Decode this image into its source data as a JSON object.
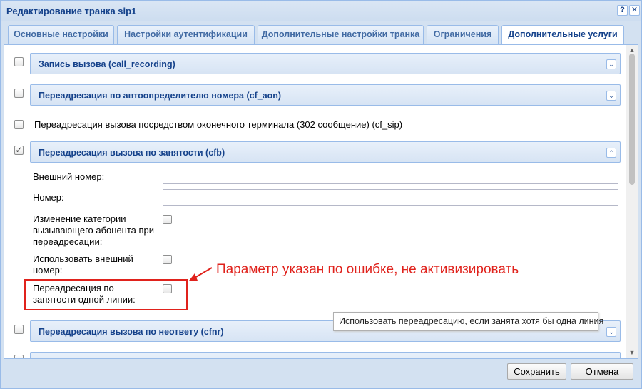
{
  "window": {
    "title": "Редактирование транка sip1",
    "help_glyph": "?",
    "close_glyph": "✕"
  },
  "tabs": [
    {
      "label": "Основные настройки"
    },
    {
      "label": "Настройки аутентификации"
    },
    {
      "label": "Дополнительные настройки транка"
    },
    {
      "label": "Ограничения"
    },
    {
      "label": "Дополнительные услуги"
    }
  ],
  "active_tab": "Дополнительные услуги",
  "services": {
    "call_recording": {
      "title": "Запись вызова (call_recording)",
      "checked": false
    },
    "cf_aon": {
      "title": "Переадресация по автоопределителю номера (cf_aon)",
      "checked": false
    },
    "cf_sip": {
      "label": "Переадресация вызова посредством оконечного терминала (302 сообщение) (cf_sip)",
      "checked": false
    },
    "cfb": {
      "title": "Переадресация вызова по занятости (cfb)",
      "checked": true,
      "check_glyph": "✓",
      "fields": {
        "external_number": {
          "label": "Внешний номер:",
          "value": ""
        },
        "number": {
          "label": "Номер:",
          "value": ""
        },
        "change_category": {
          "label": "Изменение категории вызывающего абонента при переадресации:",
          "checked": false
        },
        "use_external": {
          "label": "Использовать внешний номер:",
          "checked": false
        },
        "one_line_busy": {
          "label": "Переадресация по занятости одной линии:",
          "checked": false
        }
      }
    },
    "cfnr": {
      "title": "Переадресация вызова по неответу (cfnr)",
      "checked": false
    }
  },
  "tooltip": "Использовать переадресацию, если занята хотя бы одна линия",
  "annotation": {
    "text": "Параметр указан по ошибке, не активизировать",
    "color": "#e0221c"
  },
  "buttons": {
    "save": "Сохранить",
    "cancel": "Отмена"
  },
  "glyphs": {
    "expand": "⌄",
    "collapse": "⌃",
    "scroll_up": "▲",
    "scroll_down": "▼"
  },
  "colors": {
    "header_text": "#15428b",
    "border": "#99bbe8"
  }
}
